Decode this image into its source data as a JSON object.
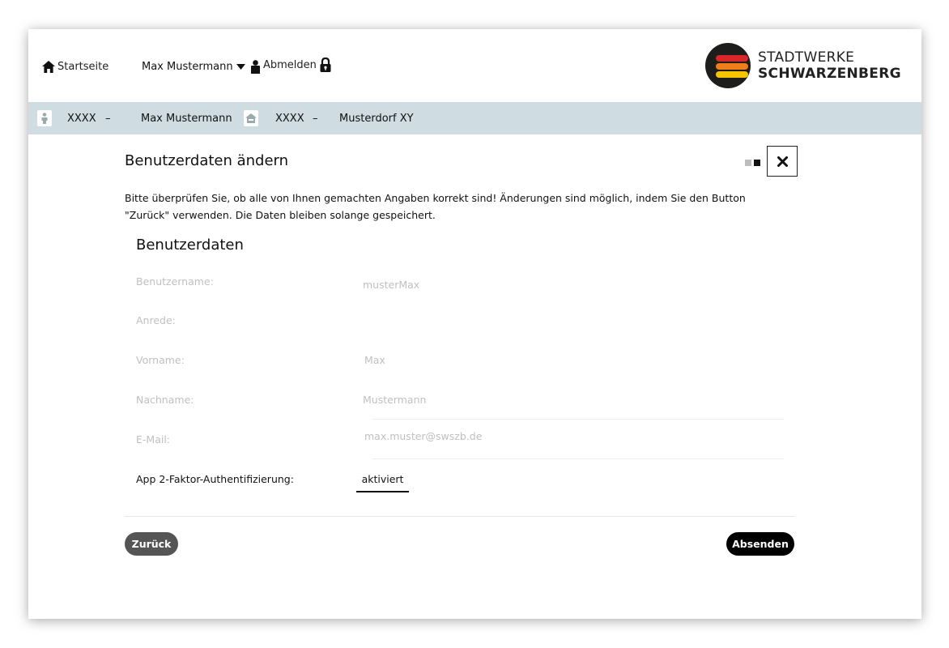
{
  "header": {
    "home_label": "Startseite",
    "user_name": "Max Mustermann",
    "logout_label": "Abmelden",
    "logo": {
      "line1": "STADTWERKE",
      "line2": "SCHWARZENBERG"
    }
  },
  "infobar": {
    "customer_number": "XXXX",
    "customer_separator": "–",
    "customer_name": "Max Mustermann",
    "property_number": "XXXX",
    "property_separator": "–",
    "property_location": "Musterdorf XY"
  },
  "main": {
    "title": "Benutzerdaten ändern",
    "intro": "Bitte überprüfen Sie, ob alle von Ihnen gemachten Angaben korrekt sind! Änderungen sind möglich, indem Sie den Button \"Zurück\" verwenden. Die Daten bleiben solange gespeichert.",
    "section_title": "Benutzerdaten",
    "fields": [
      {
        "label": "Benutzername:",
        "value": "musterMax"
      },
      {
        "label": "Anrede:",
        "value": ""
      },
      {
        "label": "Vorname:",
        "value": "Max"
      },
      {
        "label": "Nachname:",
        "value": "Mustermann"
      },
      {
        "label": "E-Mail:",
        "value": "max.muster@swszb.de"
      }
    ],
    "twofa": {
      "label": "App 2-Faktor-Authentifizierung:",
      "value": "aktiviert"
    },
    "back_button": "Zurück",
    "submit_button": "Absenden"
  },
  "colors": {
    "infobar_bg": "#cfdde2",
    "back_button_bg": "#555555",
    "submit_button_bg": "#000000",
    "logo_red": "#d9262a",
    "logo_orange": "#ef7d1a",
    "logo_yellow": "#f6c400",
    "logo_circle": "#1d1d1b"
  },
  "icons": {
    "home": "home-icon",
    "caret": "caret-down-icon",
    "user": "user-icon",
    "logout": "lock-icon",
    "customer": "person-card-icon",
    "property": "house-icon",
    "close": "close-icon"
  }
}
